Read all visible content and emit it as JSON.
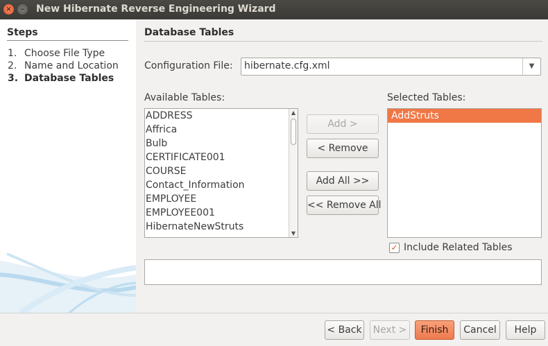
{
  "window": {
    "title": "New Hibernate Reverse Engineering Wizard",
    "close_glyph": "×",
    "minimize_glyph": "–"
  },
  "steps": {
    "heading": "Steps",
    "items": [
      {
        "num": "1.",
        "label": "Choose File Type",
        "active": false
      },
      {
        "num": "2.",
        "label": "Name and Location",
        "active": false
      },
      {
        "num": "3.",
        "label": "Database Tables",
        "active": true
      }
    ]
  },
  "main": {
    "section_title": "Database Tables",
    "config_label": "Configuration File:",
    "config_value": "hibernate.cfg.xml",
    "available_label": "Available Tables:",
    "available_tables": [
      "ADDRESS",
      "Affrica",
      "Bulb",
      "CERTIFICATE001",
      "COURSE",
      "Contact_Information",
      "EMPLOYEE",
      "EMPLOYEE001",
      "HibernateNewStruts"
    ],
    "selected_label": "Selected Tables:",
    "selected_tables": [
      "AddStruts"
    ],
    "buttons": {
      "add": "Add >",
      "remove": "< Remove",
      "add_all": "Add All >>",
      "remove_all": "<< Remove All"
    },
    "include_related_label": "Include Related Tables",
    "include_related_checked": true,
    "checkmark": "✓"
  },
  "footer": {
    "back": "< Back",
    "next": "Next >",
    "finish": "Finish",
    "cancel": "Cancel",
    "help": "Help"
  },
  "colors": {
    "accent": "#f07746",
    "titlebar": "#3c3b37"
  }
}
